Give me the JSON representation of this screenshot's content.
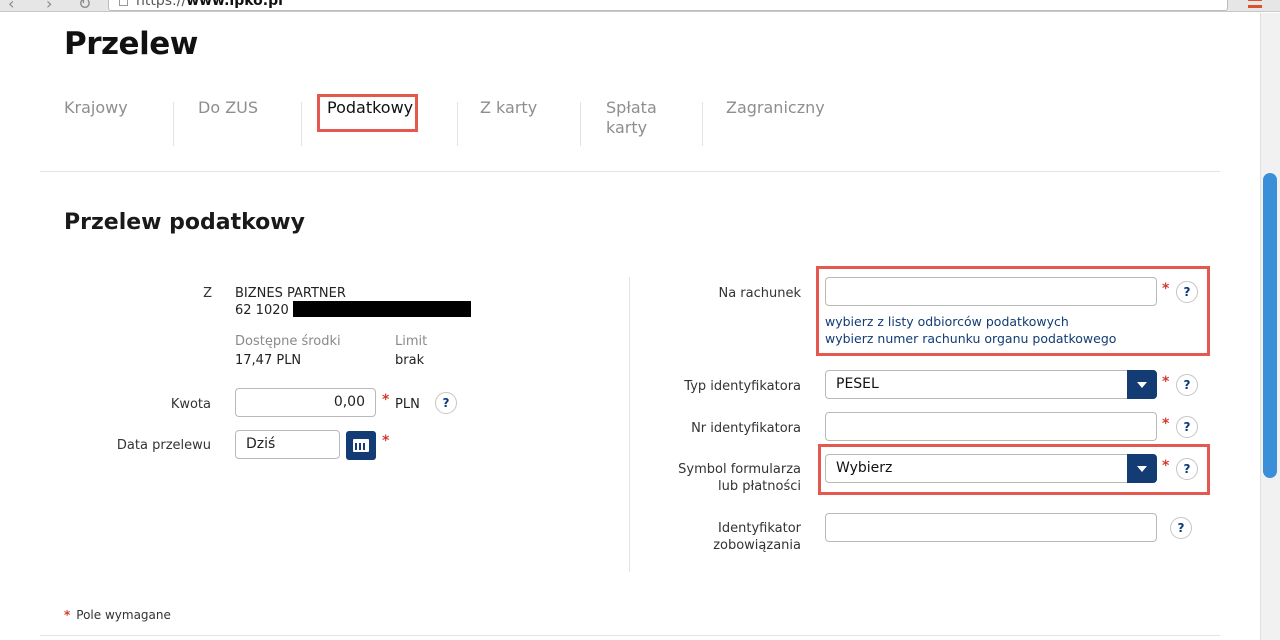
{
  "browser": {
    "url_prefix": "https://",
    "url_host": "www.ipko.pl"
  },
  "page": {
    "title": "Przelew"
  },
  "tabs": [
    {
      "label": "Krajowy",
      "active": false
    },
    {
      "label": "Do ZUS",
      "active": false
    },
    {
      "label": "Podatkowy",
      "active": true
    },
    {
      "label": "Z karty",
      "active": false
    },
    {
      "label": "Spłata karty",
      "active": false
    },
    {
      "label": "Zagraniczny",
      "active": false
    }
  ],
  "section": {
    "title": "Przelew podatkowy"
  },
  "from": {
    "label": "Z",
    "account_name": "BIZNES PARTNER",
    "account_number_visible": "62 1020",
    "available_label": "Dostępne środki",
    "available_value": "17,47 PLN",
    "limit_label": "Limit",
    "limit_value": "brak"
  },
  "amount": {
    "label": "Kwota",
    "value": "0,00",
    "currency": "PLN"
  },
  "date": {
    "label": "Data przelewu",
    "value": "Dziś"
  },
  "to_account": {
    "label": "Na rachunek",
    "value": "",
    "link_choose_recipient": "wybierz z listy odbiorców podatkowych",
    "link_choose_office": "wybierz numer rachunku organu podatkowego"
  },
  "id_type": {
    "label": "Typ identyfikatora",
    "selected": "PESEL"
  },
  "id_number": {
    "label": "Nr identyfikatora",
    "value": ""
  },
  "form_symbol": {
    "label_line1": "Symbol formularza",
    "label_line2": "lub płatności",
    "selected": "Wybierz"
  },
  "obligation_id": {
    "label_line1": "Identyfikator",
    "label_line2": "zobowiązania",
    "value": ""
  },
  "required_mark": "*",
  "help_mark": "?",
  "footer": {
    "required_note": "Pole wymagane"
  },
  "colors": {
    "accent_navy": "#123c73",
    "highlight_red": "#e4584f",
    "required_red": "#d23b2e",
    "scroll_blue": "#3b8fd9"
  }
}
